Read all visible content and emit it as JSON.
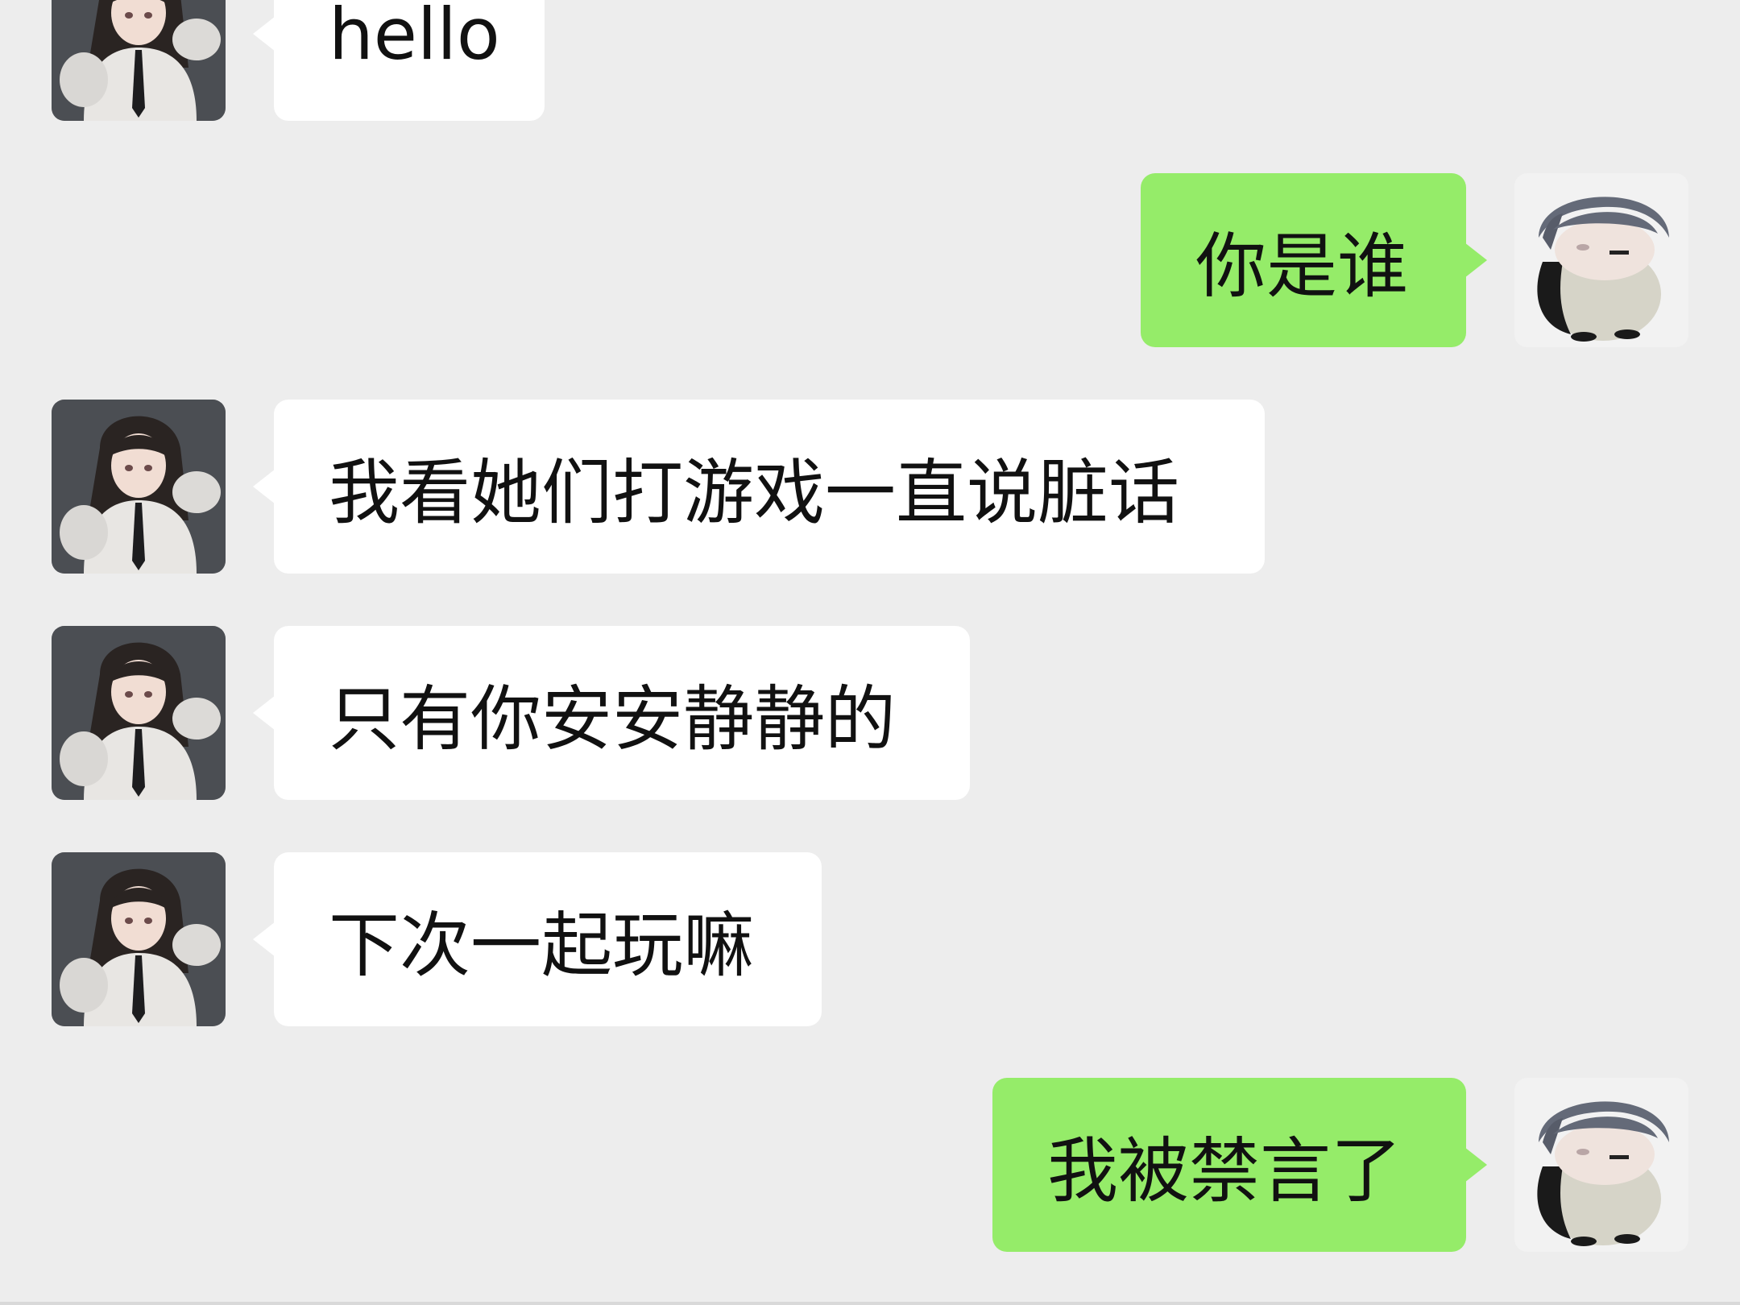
{
  "chat": {
    "messages": [
      {
        "side": "left",
        "sender": "other",
        "text": "hello"
      },
      {
        "side": "right",
        "sender": "me",
        "text": "你是谁"
      },
      {
        "side": "left",
        "sender": "other",
        "text": "我看她们打游戏一直说脏话"
      },
      {
        "side": "left",
        "sender": "other",
        "text": "只有你安安静静的"
      },
      {
        "side": "left",
        "sender": "other",
        "text": "下次一起玩嘛"
      },
      {
        "side": "right",
        "sender": "me",
        "text": "我被禁言了"
      }
    ]
  },
  "colors": {
    "background": "#ededed",
    "incoming_bubble": "#ffffff",
    "outgoing_bubble": "#95ec69",
    "text": "#111111"
  },
  "icons": {
    "other_avatar": "anime-girl-avatar-icon",
    "my_avatar": "penguin-avatar-icon"
  }
}
